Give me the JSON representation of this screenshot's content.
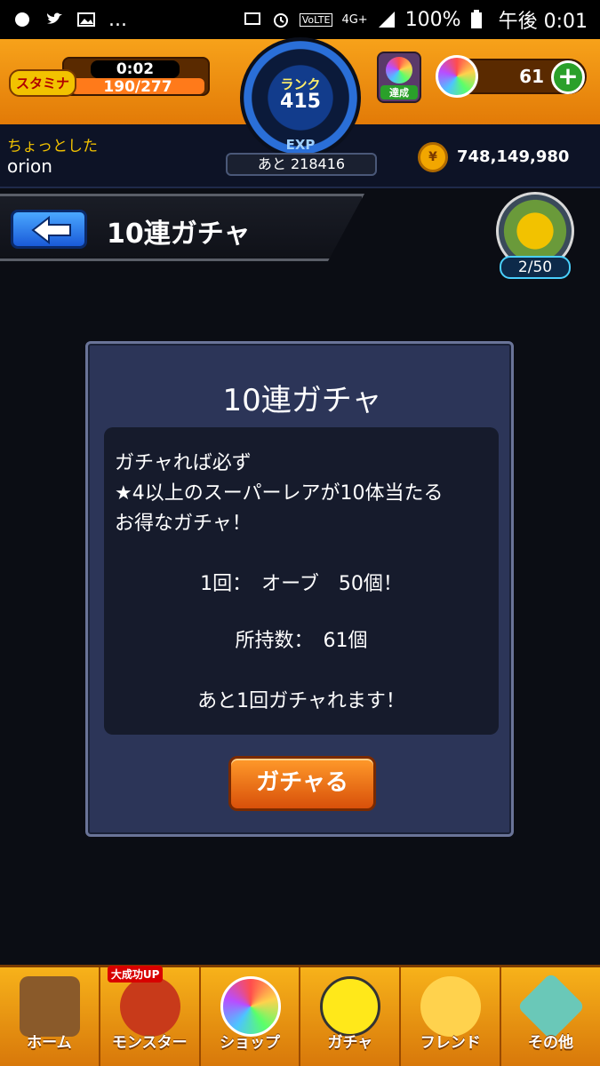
{
  "statusbar": {
    "battery": "100%",
    "time": "午後 0:01",
    "network": "4G+",
    "volte": "VoLTE",
    "more": "..."
  },
  "header": {
    "stamina_label": "スタミナ",
    "stamina_timer": "0:02",
    "stamina_value": "190/277",
    "rank_label": "ランク",
    "rank_value": "415",
    "exp_label": "EXP",
    "exp_remaining": "あと 218416",
    "achievement_label": "達成",
    "orb_count": "61",
    "user_title": "ちょっとした",
    "user_name": "orion",
    "coins": "748,149,980"
  },
  "page": {
    "title": "10連ガチャ",
    "badge_count": "2/50"
  },
  "dialog": {
    "title": "10連ガチャ",
    "desc_line1": "ガチャれば必ず",
    "desc_line2": "★4以上のスーパーレアが10体当たる",
    "desc_line3": "お得なガチャ！",
    "cost_line": "1回：　オーブ　50個！",
    "owned_line": "所持数：　61個",
    "remaining_line": "あと1回ガチャれます！",
    "button_label": "ガチャる"
  },
  "bottom_nav": {
    "items": [
      {
        "label": "ホーム"
      },
      {
        "label": "モンスター",
        "badge": "大成功UP"
      },
      {
        "label": "ショップ"
      },
      {
        "label": "ガチャ"
      },
      {
        "label": "フレンド"
      },
      {
        "label": "その他"
      }
    ]
  },
  "colors": {
    "header_orange": "#f7a21a",
    "dialog_bg": "#2c3558",
    "button_orange": "#ff9a2a"
  }
}
